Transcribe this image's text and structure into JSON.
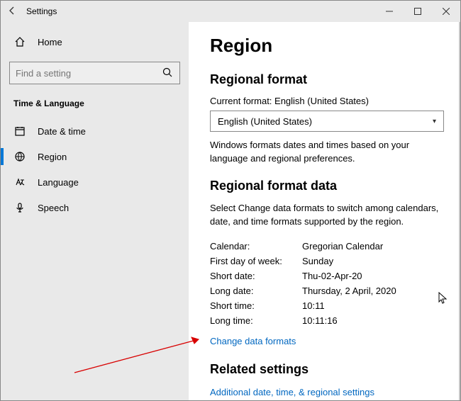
{
  "titlebar": {
    "title": "Settings"
  },
  "sidebar": {
    "home": "Home",
    "search_placeholder": "Find a setting",
    "section": "Time & Language",
    "items": [
      {
        "label": "Date & time"
      },
      {
        "label": "Region"
      },
      {
        "label": "Language"
      },
      {
        "label": "Speech"
      }
    ]
  },
  "main": {
    "title": "Region",
    "format_heading": "Regional format",
    "current_label": "Current format: English (United States)",
    "select_value": "English (United States)",
    "format_desc": "Windows formats dates and times based on your language and regional preferences.",
    "data_heading": "Regional format data",
    "data_desc": "Select Change data formats to switch among calendars, date, and time formats supported by the region.",
    "rows": {
      "calendar_k": "Calendar:",
      "calendar_v": "Gregorian Calendar",
      "firstday_k": "First day of week:",
      "firstday_v": "Sunday",
      "shortdate_k": "Short date:",
      "shortdate_v": "Thu-02-Apr-20",
      "longdate_k": "Long date:",
      "longdate_v": "Thursday, 2 April, 2020",
      "shorttime_k": "Short time:",
      "shorttime_v": "10:11",
      "longtime_k": "Long time:",
      "longtime_v": "10:11:16"
    },
    "change_link": "Change data formats",
    "related_heading": "Related settings",
    "related_link": "Additional date, time, & regional settings"
  }
}
